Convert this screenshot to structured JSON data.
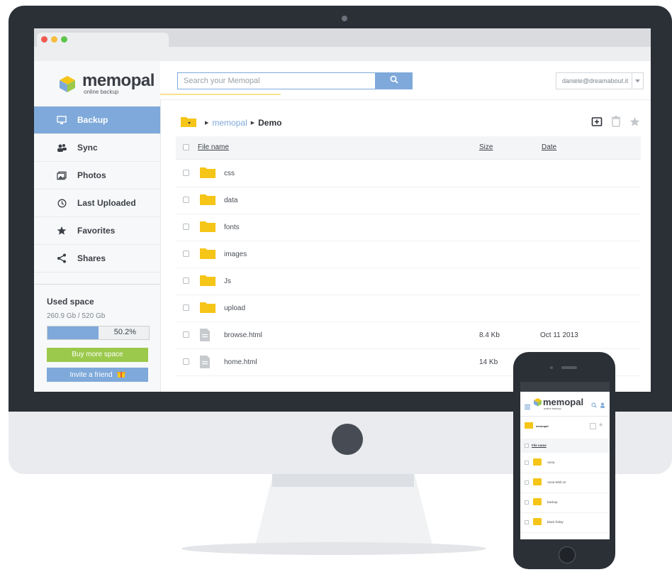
{
  "brand": {
    "name": "memopal",
    "tagline": "online backup"
  },
  "search": {
    "placeholder": "Search your Memopal"
  },
  "user": {
    "email": "daniele@dreamabout.it"
  },
  "sidebar": {
    "items": [
      {
        "label": "Backup",
        "icon": "monitor-icon",
        "active": true
      },
      {
        "label": "Sync",
        "icon": "sync-users-icon",
        "active": false
      },
      {
        "label": "Photos",
        "icon": "photos-icon",
        "active": false
      },
      {
        "label": "Last Uploaded",
        "icon": "clock-icon",
        "active": false
      },
      {
        "label": "Favorites",
        "icon": "star-icon",
        "active": false
      },
      {
        "label": "Shares",
        "icon": "share-icon",
        "active": false
      }
    ],
    "used_space_label": "Used space",
    "used_space_value": "260.9 Gb / 520 Gb",
    "usage_percent_label": "50.2%",
    "usage_fraction": 0.502,
    "buy_label": "Buy more space",
    "invite_label": "Invite a friend"
  },
  "breadcrumb": {
    "root": "memopal",
    "current": "Demo"
  },
  "table": {
    "headers": {
      "name": "File name",
      "size": "Size",
      "date": "Date"
    },
    "rows": [
      {
        "type": "folder",
        "name": "css",
        "size": "",
        "date": ""
      },
      {
        "type": "folder",
        "name": "data",
        "size": "",
        "date": ""
      },
      {
        "type": "folder",
        "name": "fonts",
        "size": "",
        "date": ""
      },
      {
        "type": "folder",
        "name": "images",
        "size": "",
        "date": ""
      },
      {
        "type": "folder",
        "name": "Js",
        "size": "",
        "date": ""
      },
      {
        "type": "folder",
        "name": "upload",
        "size": "",
        "date": ""
      },
      {
        "type": "file",
        "name": "browse.html",
        "size": "8.4 Kb",
        "date": "Oct 11 2013"
      },
      {
        "type": "file",
        "name": "home.html",
        "size": "14 Kb",
        "date": ""
      }
    ]
  },
  "phone": {
    "brand": "memopal",
    "tagline": "online backup",
    "breadcrumb": "memopal",
    "file_header": "File name",
    "rows": [
      "Avria",
      "Avria Web UI",
      "backup",
      "black friday"
    ]
  },
  "colors": {
    "accent": "#7ea9da",
    "buy": "#9bc94c",
    "folder": "#f5c518"
  }
}
